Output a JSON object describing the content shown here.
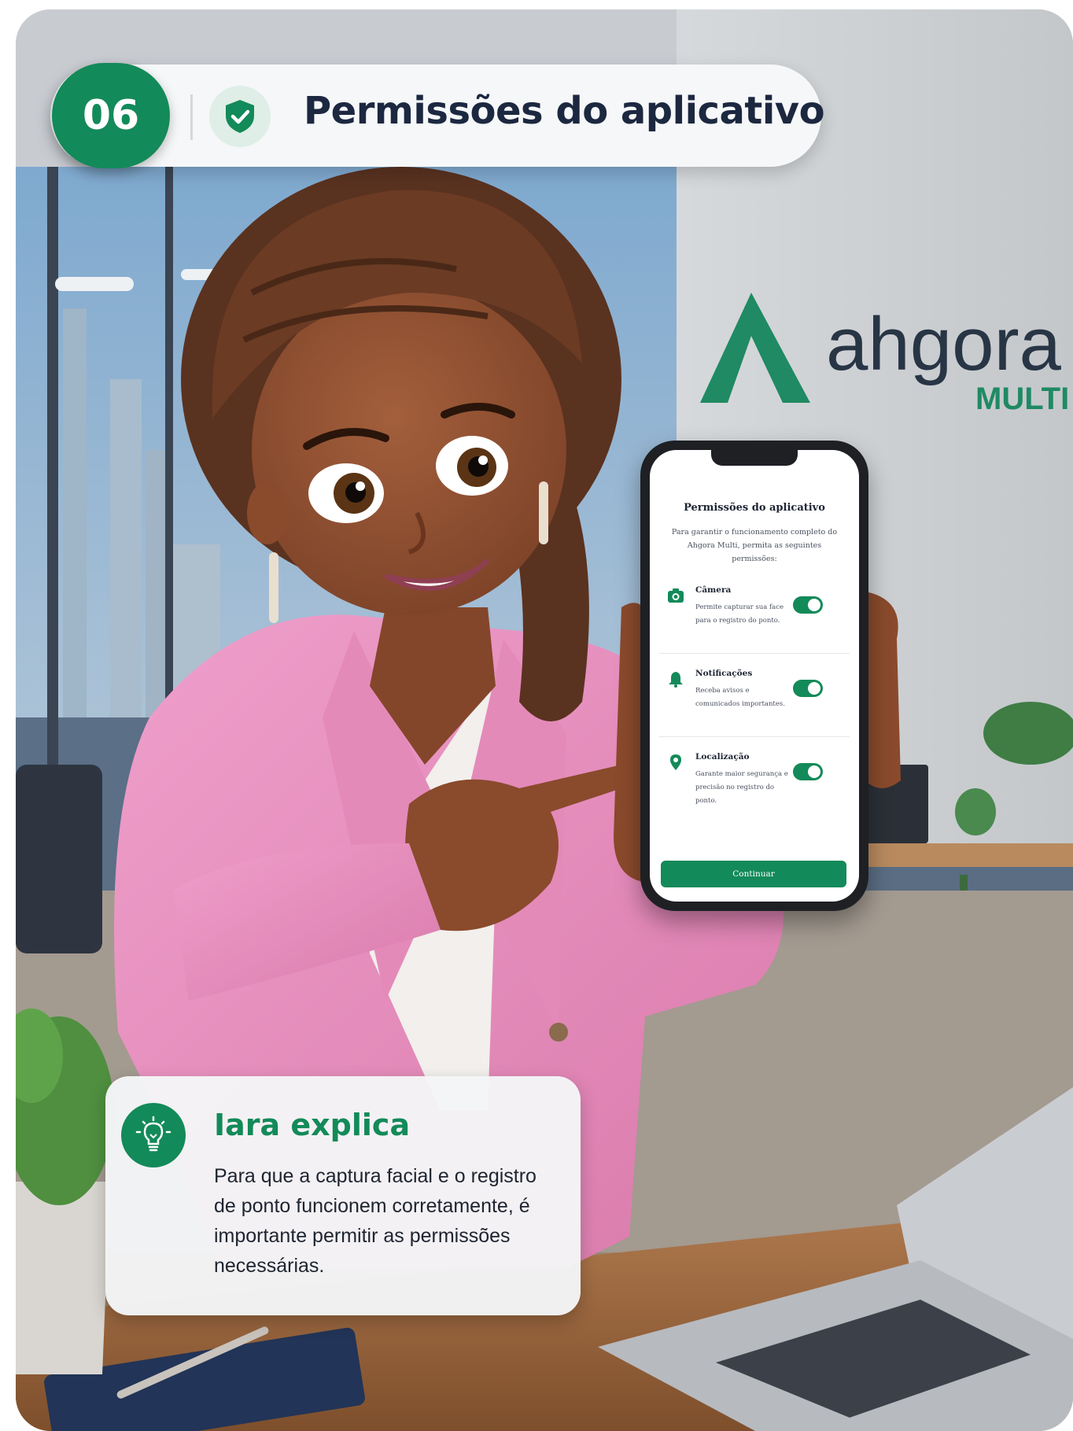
{
  "header": {
    "step_number": "06",
    "title": "Permissões do aplicativo",
    "icon": "shield-check-icon"
  },
  "background": {
    "brand_name": "ahgora",
    "brand_sub": "MULTI"
  },
  "phone": {
    "title": "Permissões do aplicativo",
    "description": "Para garantir o funcionamento completo do Ahgora Multi, permita as seguintes permissões:",
    "permissions": [
      {
        "icon": "camera-icon",
        "name": "Câmera",
        "description": "Permite capturar sua face para o registro do ponto.",
        "enabled": true
      },
      {
        "icon": "bell-icon",
        "name": "Notificações",
        "description": "Receba avisos e comunicados importantes.",
        "enabled": true
      },
      {
        "icon": "location-pin-icon",
        "name": "Localização",
        "description": "Garante maior segurança e precisão no registro do ponto.",
        "enabled": true
      }
    ],
    "continue_label": "Continuar"
  },
  "explain": {
    "icon": "lightbulb-icon",
    "title": "Iara explica",
    "body": "Para que a captura facial e o registro de ponto funcionem corretamente, é importante permitir as permissões necessárias."
  },
  "colors": {
    "brand_green": "#138a59",
    "title_navy": "#1c2840",
    "jacket_pink": "#e58fbd"
  }
}
